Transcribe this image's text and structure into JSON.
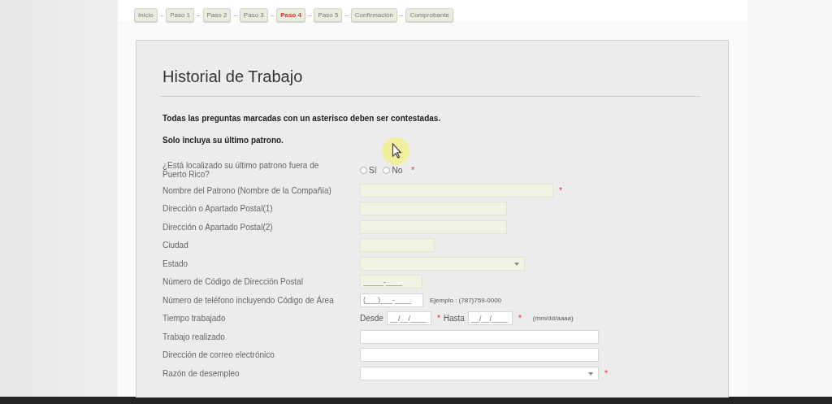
{
  "steps": [
    {
      "label": "Inicio",
      "selected": false
    },
    {
      "label": "Paso 1",
      "selected": false
    },
    {
      "label": "Paso 2",
      "selected": false
    },
    {
      "label": "Paso 3",
      "selected": false
    },
    {
      "label": "Paso 4",
      "selected": true
    },
    {
      "label": "Paso 5",
      "selected": false
    },
    {
      "label": "Confirmación",
      "selected": false
    },
    {
      "label": "Comprobante",
      "selected": false
    }
  ],
  "step_separator": "–",
  "title": "Historial de Trabajo",
  "notes": [
    "Todas las preguntas marcadas con un asterisco deben ser contestadas.",
    "Solo incluya su último patrono."
  ],
  "required_mark": "*",
  "fields": [
    {
      "kind": "radio",
      "label": "¿Está localizado su último patrono fuera de Puerto Rico?",
      "required": true,
      "options": [
        {
          "label": "Sí",
          "selected": false
        },
        {
          "label": "No",
          "selected": false
        }
      ]
    },
    {
      "kind": "text",
      "label": "Nombre del Patrono (Nombre de la Compañía)",
      "required": true,
      "disabled": true
    },
    {
      "kind": "text",
      "label": "Dirección o Apartado Postal(1)",
      "required": false,
      "disabled": true
    },
    {
      "kind": "text",
      "label": "Dirección o Apartado Postal(2)",
      "required": false,
      "disabled": true
    },
    {
      "kind": "text",
      "label": "Ciudad",
      "required": false,
      "disabled": true
    },
    {
      "kind": "select",
      "label": "Estado",
      "required": false,
      "disabled": true
    },
    {
      "kind": "text",
      "label": "Número de Código de Dirección Postal",
      "required": false,
      "disabled": true,
      "placeholder": "_____-____"
    },
    {
      "kind": "text",
      "label": "Número de teléfono incluyendo Código de Área",
      "required": false,
      "disabled": false,
      "placeholder": "(___)___-____",
      "hint": "Ejemplo : (787)759-0000"
    },
    {
      "kind": "dates",
      "label": "Tiempo trabajado",
      "from_label": "Desde",
      "from_placeholder": "__/__/____",
      "to_label": "Hasta",
      "to_placeholder": "__/__/____",
      "required": true,
      "hint": "(mm/dd/aaaa)"
    },
    {
      "kind": "text",
      "label": "Trabajo realizado",
      "required": false,
      "disabled": false
    },
    {
      "kind": "text",
      "label": "Dirección de correo electrónico",
      "required": false,
      "disabled": false
    },
    {
      "kind": "select",
      "label": "Razón de desempleo",
      "required": true,
      "disabled": false
    }
  ]
}
